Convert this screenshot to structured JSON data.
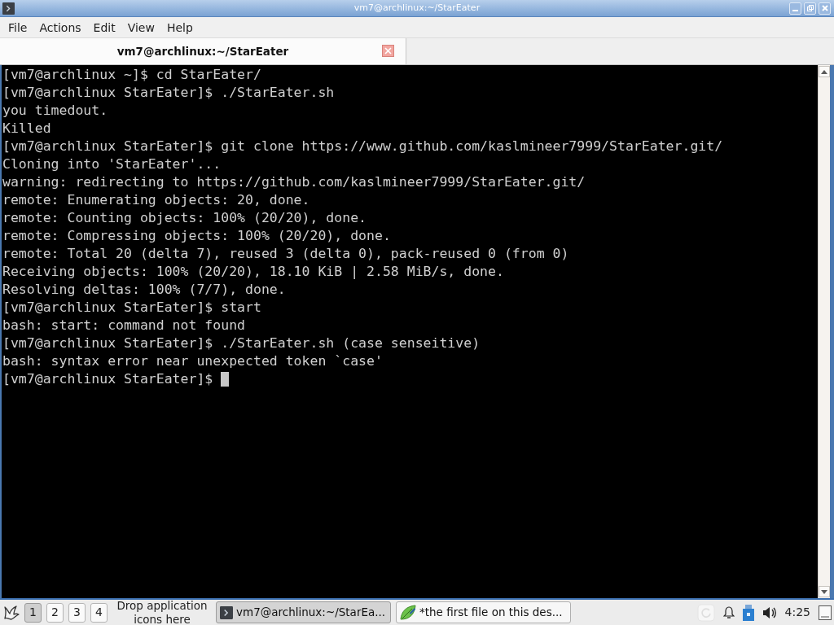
{
  "window": {
    "title": "vm7@archlinux:~/StarEater"
  },
  "menu_bar": {
    "items": [
      "File",
      "Actions",
      "Edit",
      "View",
      "Help"
    ]
  },
  "tabs": [
    {
      "label": "vm7@archlinux:~/StarEater",
      "selected": true
    }
  ],
  "terminal": {
    "lines": [
      "[vm7@archlinux ~]$ cd StarEater/",
      "[vm7@archlinux StarEater]$ ./StarEater.sh",
      "you timedout.",
      "Killed",
      "[vm7@archlinux StarEater]$ git clone https://www.github.com/kaslmineer7999/StarEater.git/",
      "Cloning into 'StarEater'...",
      "warning: redirecting to https://github.com/kaslmineer7999/StarEater.git/",
      "remote: Enumerating objects: 20, done.",
      "remote: Counting objects: 100% (20/20), done.",
      "remote: Compressing objects: 100% (20/20), done.",
      "remote: Total 20 (delta 7), reused 3 (delta 0), pack-reused 0 (from 0)",
      "Receiving objects: 100% (20/20), 18.10 KiB | 2.58 MiB/s, done.",
      "Resolving deltas: 100% (7/7), done.",
      "[vm7@archlinux StarEater]$ start",
      "bash: start: command not found",
      "[vm7@archlinux StarEater]$ ./StarEater.sh (case senseitive)",
      "bash: syntax error near unexpected token `case'",
      "[vm7@archlinux StarEater]$"
    ]
  },
  "taskbar": {
    "desktops": [
      {
        "label": "1",
        "selected": true
      },
      {
        "label": "2",
        "selected": false
      },
      {
        "label": "3",
        "selected": false
      },
      {
        "label": "4",
        "selected": false
      }
    ],
    "launcher_hint": "Drop application icons here",
    "tasks": [
      {
        "kind": "terminal",
        "label": "vm7@archlinux:~/StarEa...",
        "selected": true
      },
      {
        "kind": "editor",
        "label": "*the first file on this des...",
        "selected": false
      }
    ],
    "clock": "4:25"
  }
}
